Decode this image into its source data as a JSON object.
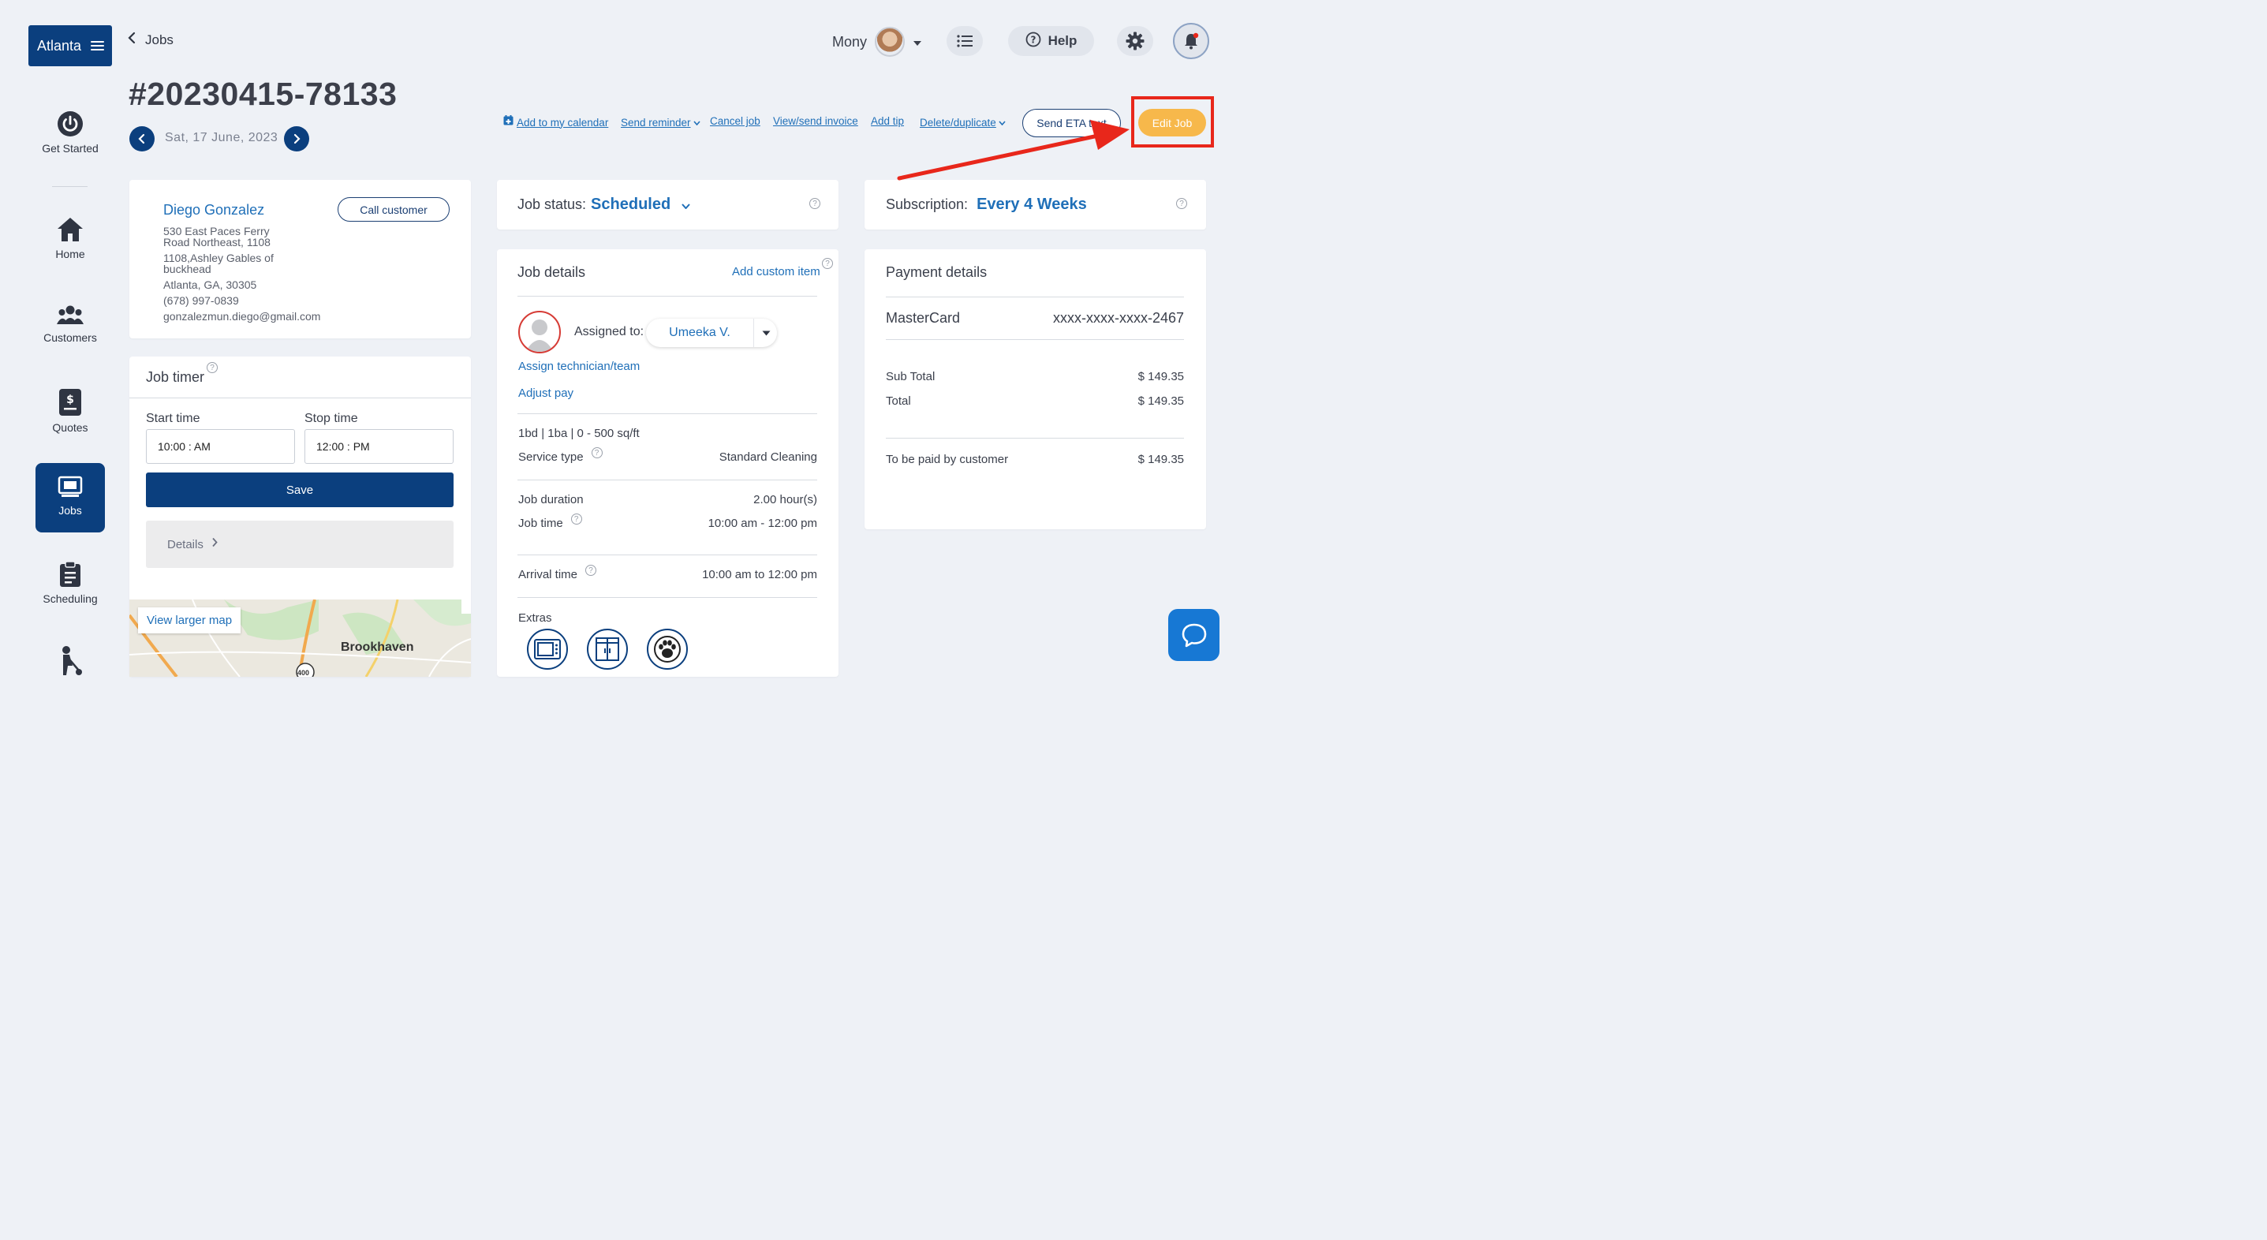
{
  "brand": {
    "name": "Atlanta"
  },
  "sidebar": {
    "items": [
      {
        "label": "Get Started",
        "icon": "power-icon"
      },
      {
        "label": "Home",
        "icon": "home-icon"
      },
      {
        "label": "Customers",
        "icon": "users-icon"
      },
      {
        "label": "Quotes",
        "icon": "quote-icon"
      },
      {
        "label": "Jobs",
        "icon": "jobs-icon"
      },
      {
        "label": "Scheduling",
        "icon": "clipboard-icon"
      }
    ]
  },
  "header": {
    "back_label": "Jobs",
    "job_number": "#20230415-78133",
    "date": "Sat, 17 June, 2023",
    "user_name": "Mony",
    "help_label": "Help"
  },
  "actions": {
    "add_calendar": "Add to my calendar",
    "send_reminder": "Send reminder",
    "cancel_job": "Cancel job",
    "view_invoice": "View/send invoice",
    "add_tip": "Add tip",
    "delete_duplicate": "Delete/duplicate",
    "send_eta": "Send ETA text",
    "edit_job": "Edit Job"
  },
  "customer": {
    "name": "Diego Gonzalez",
    "call_label": "Call customer",
    "address1a": "530 East Paces Ferry",
    "address1b": "Road Northeast, 1108",
    "address2a": "1108,Ashley Gables of",
    "address2b": "buckhead",
    "city": "Atlanta, GA, 30305",
    "phone": "(678) 997-0839",
    "email": "gonzalezmun.diego@gmail.com"
  },
  "timer": {
    "title": "Job timer",
    "start_label": "Start time",
    "start_value": "10:00 : AM",
    "stop_label": "Stop time",
    "stop_value": "12:00 : PM",
    "save_label": "Save",
    "details_label": "Details"
  },
  "map": {
    "view_larger": "View larger map",
    "place": "Brookhaven",
    "road": "400"
  },
  "job_status": {
    "label": "Job status:",
    "value": "Scheduled"
  },
  "job_details": {
    "title": "Job details",
    "add_custom": "Add custom item",
    "assigned_label": "Assigned to:",
    "assigned_value": "Umeeka V.",
    "assign_team": "Assign technician/team",
    "adjust_pay": "Adjust pay",
    "size": "1bd | 1ba | 0 - 500 sq/ft",
    "service_type_label": "Service type",
    "service_type_value": "Standard Cleaning",
    "duration_label": "Job duration",
    "duration_value": "2.00 hour(s)",
    "time_label": "Job time",
    "time_value": "10:00 am - 12:00 pm",
    "arrival_label": "Arrival time",
    "arrival_value": "10:00 am to 12:00 pm",
    "extras_label": "Extras"
  },
  "subscription": {
    "label": "Subscription:",
    "value": "Every 4 Weeks"
  },
  "payment": {
    "title": "Payment details",
    "card_type": "MasterCard",
    "card_number": "xxxx-xxxx-xxxx-2467",
    "subtotal_label": "Sub Total",
    "subtotal_value": "$ 149.35",
    "total_label": "Total",
    "total_value": "$ 149.35",
    "paid_by_label": "To be paid by customer",
    "paid_by_value": "$ 149.35"
  },
  "colors": {
    "brand": "#0b3f7e",
    "link": "#1f6fb8",
    "edit": "#f7b84b",
    "annotation": "#e8271b"
  }
}
